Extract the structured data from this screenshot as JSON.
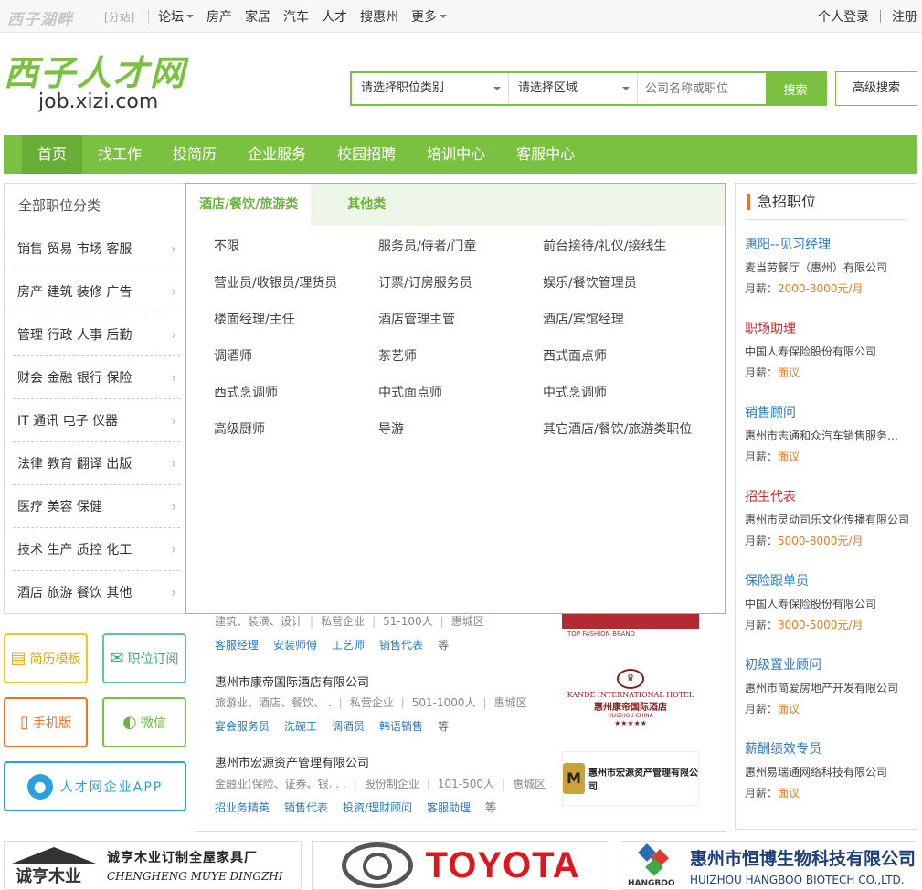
{
  "topbar": {
    "site_logo": "西子湖畔",
    "fenzhan": "[分站]",
    "nav": [
      {
        "label": "论坛",
        "dropdown": true
      },
      {
        "label": "房产"
      },
      {
        "label": "家居"
      },
      {
        "label": "汽车"
      },
      {
        "label": "人才"
      },
      {
        "label": "搜惠州"
      },
      {
        "label": "更多",
        "dropdown": true
      }
    ],
    "login": "个人登录",
    "register": "注册"
  },
  "brand": {
    "name": "西子人才网",
    "url": "job.xizi.com"
  },
  "search": {
    "category_label": "请选择职位类别",
    "area_label": "请选择区域",
    "keyword_placeholder": "公司名称或职位",
    "button": "搜索",
    "advanced": "高级搜索"
  },
  "mainnav": [
    "首页",
    "找工作",
    "投简历",
    "企业服务",
    "校园招聘",
    "培训中心",
    "客服中心"
  ],
  "categories": {
    "title": "全部职位分类",
    "items": [
      "销售 贸易 市场 客服",
      "房产 建筑 装修 广告",
      "管理 行政 人事 后勤",
      "财会 金融 银行 保险",
      "IT 通讯 电子 仪器",
      "法律 教育 翻译 出版",
      "医疗 美容 保健",
      "技术 生产 质控 化工",
      "酒店 旅游 餐饮 其他"
    ]
  },
  "panel": {
    "tabs": [
      "酒店/餐饮/旅游类",
      "其他类"
    ],
    "items": [
      "不限",
      "服务员/侍者/门童",
      "前台接待/礼仪/接线生",
      "营业员/收银员/理货员",
      "订票/订房服务员",
      "娱乐/餐饮管理员",
      "楼面经理/主任",
      "酒店管理主管",
      "酒店/宾馆经理",
      "调酒师",
      "茶艺师",
      "西式面点师",
      "西式烹调师",
      "中式面点师",
      "中式烹调师",
      "高级厨师",
      "导游",
      "其它酒店/餐饮/旅游类职位"
    ]
  },
  "companies": [
    {
      "name": "",
      "info": [
        "建筑、装潢、设计",
        "私营企业",
        "51-100人",
        "惠城区"
      ],
      "jobs": [
        "客服经理",
        "安装师傅",
        "工艺师",
        "销售代表"
      ],
      "etc": "等",
      "logo_sub": "TOP FASHION BRAND"
    },
    {
      "name": "惠州市康帝国际酒店有限公司",
      "info": [
        "旅游业、酒店、餐饮、 .",
        "私营企业",
        "501-1000人",
        "惠城区"
      ],
      "jobs": [
        "宴会服务员",
        "洗碗工",
        "调酒员",
        "韩语销售"
      ],
      "etc": "等",
      "logo_en": "KANDE INTERNATIONAL HOTEL",
      "logo_cn": "惠州康帝国际酒店",
      "logo_sub": "HUIZHOU CHINA",
      "logo_stars": "★★★★★"
    },
    {
      "name": "惠州市宏源资产管理有限公司",
      "info": [
        "金融业(保险、证券、银. . .",
        "股份制企业",
        "101-500人",
        "惠城区"
      ],
      "jobs": [
        "招业务精英",
        "销售代表",
        "投资/理财顾问",
        "客服助理"
      ],
      "etc": "等",
      "logo_cn": "惠州市宏源资产管理有限公司"
    }
  ],
  "tools": {
    "resume": "简历模板",
    "subscribe": "职位订阅",
    "mobile": "手机版",
    "wechat": "微信",
    "app": "人才网企业APP"
  },
  "urgent": {
    "title": "急招职位",
    "salary_label": "月薪：",
    "jobs": [
      {
        "title": "惠阳--见习经理",
        "company": "麦当劳餐厅（惠州）有限公司",
        "salary": "2000-3000元/月",
        "color": "#2a7bc4"
      },
      {
        "title": "职场助理",
        "company": "中国人寿保险股份有限公司",
        "salary": "面议",
        "color": "#d0262c"
      },
      {
        "title": "销售顾问",
        "company": "惠州市志通和众汽车销售服务有限公司",
        "salary": "面议",
        "color": "#2a7bc4"
      },
      {
        "title": "招生代表",
        "company": "惠州市灵动司乐文化传播有限公司",
        "salary": "5000-8000元/月",
        "color": "#d0262c"
      },
      {
        "title": "保险跟单员",
        "company": "中国人寿保险股份有限公司",
        "salary": "3000-5000元/月",
        "color": "#2a7bc4"
      },
      {
        "title": "初级置业顾问",
        "company": "惠州市简爱房地产开发有限公司",
        "salary": "面议",
        "color": "#2a7bc4"
      },
      {
        "title": "薪酬绩效专员",
        "company": "惠州易瑞通网络科技有限公司",
        "salary": "面议",
        "color": "#2a7bc4"
      }
    ]
  },
  "ads": {
    "chengheng_cn": "诚亨木业",
    "chengheng_slogan": "诚亨木业订制全屋家具厂",
    "chengheng_en": "CHENGHENG MUYE DINGZHI",
    "toyota": "TOYOTA",
    "hangboo_cn": "惠州市恒博生物科技有限公司",
    "hangboo_en": "HUIZHOU HANGBOO BIOTECH CO.,LTD.",
    "hangboo_logo": "HANGBOO"
  },
  "colors": {
    "green": "#7ac142",
    "orange": "#f37021",
    "blue": "#2a7bc4",
    "red": "#d0262c"
  }
}
